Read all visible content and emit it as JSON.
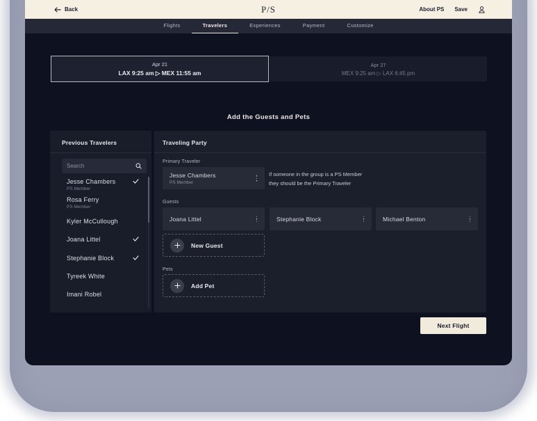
{
  "topbar": {
    "back_label": "Back",
    "logo": "P/S",
    "about_label": "About PS",
    "save_label": "Save"
  },
  "nav_tabs": [
    {
      "label": "Flights",
      "active": false
    },
    {
      "label": "Travelers",
      "active": true
    },
    {
      "label": "Experiences",
      "active": false
    },
    {
      "label": "Payment",
      "active": false
    },
    {
      "label": "Customize",
      "active": false
    }
  ],
  "flights": {
    "outbound": {
      "date": "Apr 21",
      "route": "LAX 9:25 am ▷ MEX 11:55 am",
      "selected": true
    },
    "return": {
      "date": "Apr 27",
      "route": "MEX 9:25 am ▷ LAX 6:45 pm",
      "selected": false
    }
  },
  "heading": "Add the Guests and Pets",
  "previous_travelers": {
    "title": "Previous Travelers",
    "search_placeholder": "Search",
    "items": [
      {
        "name": "Jesse Chambers",
        "subtitle": "PS Member",
        "checked": true
      },
      {
        "name": "Rosa Ferry",
        "subtitle": "PS Member",
        "checked": false
      },
      {
        "name": "Kyler McCullough",
        "checked": false
      },
      {
        "name": "Joana Littel",
        "checked": true
      },
      {
        "name": "Stephanie Block",
        "checked": true
      },
      {
        "name": "Tyreek White",
        "checked": false
      },
      {
        "name": "Imani Robel",
        "checked": false
      }
    ]
  },
  "traveling_party": {
    "title": "Traveling Party",
    "primary_label": "Primary Traveler",
    "primary": {
      "name": "Jesse Chambers",
      "subtitle": "PS Member"
    },
    "primary_note": [
      "If someone in the group is a PS Member",
      "they should be the Primary Traveler"
    ],
    "guests_label": "Guests",
    "guests": [
      {
        "name": "Joana Littel"
      },
      {
        "name": "Stephanie Block"
      },
      {
        "name": "Michael Benton"
      }
    ],
    "new_guest_label": "New Guest",
    "pets_label": "Pets",
    "add_pet_label": "Add Pet"
  },
  "footer": {
    "next_flight_label": "Next Flight"
  },
  "colors": {
    "cream": "#f6f0e3",
    "window_bg": "#0d1120",
    "navbar_bg": "#242837",
    "panel_bg": "#1a1e2a",
    "card_bg": "#272b38",
    "bezel": "#9ba0b4"
  }
}
